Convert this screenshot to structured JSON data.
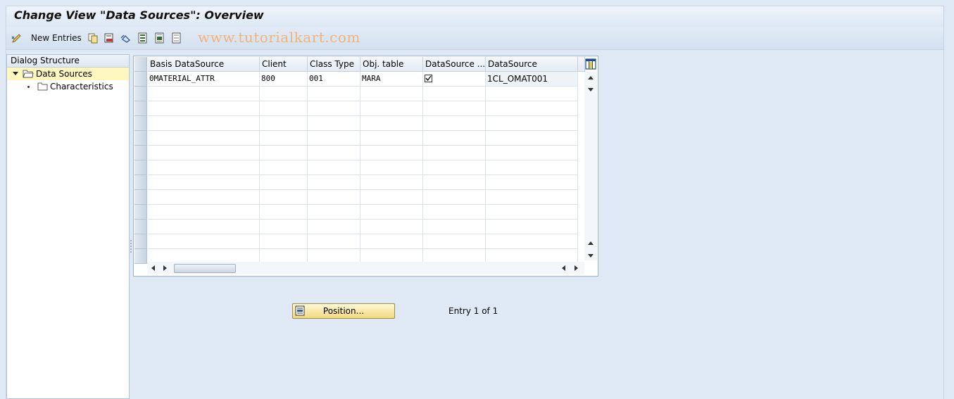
{
  "window": {
    "title": "Change View \"Data Sources\": Overview"
  },
  "toolbar": {
    "new_entries_label": "New Entries",
    "watermark": "www.tutorialkart.com",
    "icons": [
      "edit-toggle-icon",
      "copy-icon",
      "delete-icon",
      "undo-icon",
      "select-all-icon",
      "select-block-icon",
      "deselect-all-icon"
    ]
  },
  "dialog_structure": {
    "title": "Dialog Structure",
    "items": [
      {
        "label": "Data Sources",
        "level": 0,
        "expanded": true,
        "selected": true
      },
      {
        "label": "Characteristics",
        "level": 1,
        "expanded": false,
        "selected": false
      }
    ]
  },
  "table": {
    "columns": [
      "Basis DataSource",
      "Client",
      "Class Type",
      "Obj. table",
      "DataSource ...",
      "DataSource"
    ],
    "rows": [
      {
        "basis_datasource": "0MATERIAL_ATTR",
        "client": "800",
        "class_type": "001",
        "obj_table": "MARA",
        "datasource_flag": true,
        "datasource": "1CL_OMAT001"
      }
    ],
    "empty_rows": 12
  },
  "footer": {
    "position_button": "Position...",
    "entry_text": "Entry 1 of 1"
  },
  "colors": {
    "background": "#dfe9f5",
    "selected_tree": "#fff7bf",
    "button": "#f2d77e",
    "watermark": "#f1b37c"
  }
}
